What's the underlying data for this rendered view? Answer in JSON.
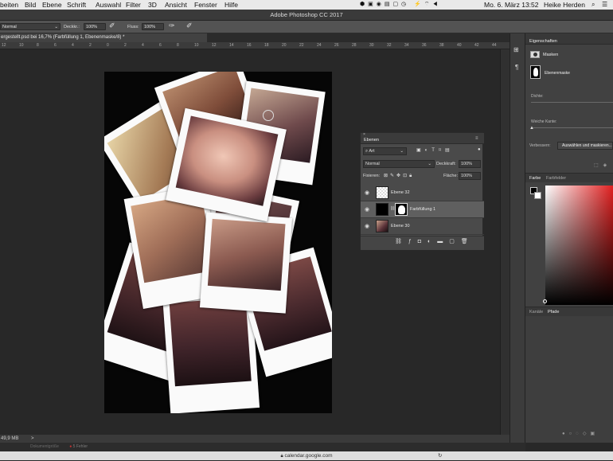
{
  "menubar": {
    "items": [
      "beiten",
      "Bild",
      "Ebene",
      "Schrift",
      "Auswahl",
      "Filter",
      "3D",
      "Ansicht",
      "Fenster",
      "Hilfe"
    ],
    "datetime": "Mo. 6. März 13:52",
    "user": "Heike Herden"
  },
  "window": {
    "title": "Adobe Photoshop CC 2017"
  },
  "options": {
    "mode": "Normal",
    "opacity_label": "Deckkr.:",
    "opacity_value": "100%",
    "flow_label": "Fluss:",
    "flow_value": "100%"
  },
  "document": {
    "tab_title": "ergestellt.psd bei 16,7% (Farbfüllung 1, Ebenenmaske/8) *",
    "ruler_ticks": [
      "12",
      "10",
      "8",
      "6",
      "4",
      "2",
      "0",
      "2",
      "4",
      "6",
      "8",
      "10",
      "12",
      "14",
      "16",
      "18",
      "20",
      "22",
      "24",
      "26",
      "28",
      "30",
      "32",
      "34",
      "36",
      "38",
      "40",
      "42",
      "44"
    ],
    "zoom": "49,9 MB",
    "status_extra": ">"
  },
  "bottombar": {
    "text1": "Dokumentgröße",
    "text2": "5 Fehler"
  },
  "safari": {
    "url": "calendar.google.com"
  },
  "layers_panel": {
    "title": "Ebenen",
    "filter": "Art",
    "blend": "Normal",
    "opacity_label": "Deckkraft:",
    "opacity_value": "100%",
    "lock_label": "Fixieren:",
    "fill_label": "Fläche:",
    "fill_value": "100%",
    "layers": [
      {
        "name": "Ebene 32"
      },
      {
        "name": "Farbfüllung 1"
      },
      {
        "name": "Ebene 30"
      }
    ]
  },
  "properties_panel": {
    "title": "Eigenschaften",
    "masks_label": "Masken",
    "layer_mask_label": "Ebenenmaske",
    "density_label": "Dichte:",
    "feather_label": "Weiche Kante:",
    "refine_label": "Verbessern:",
    "refine_button": "Auswählen und maskieren..."
  },
  "color_panel": {
    "tab1": "Farbe",
    "tab2": "Farbfelder",
    "accent": "#e02020"
  },
  "channels_panel": {
    "tab1": "Kanäle",
    "tab2": "Pfade"
  }
}
